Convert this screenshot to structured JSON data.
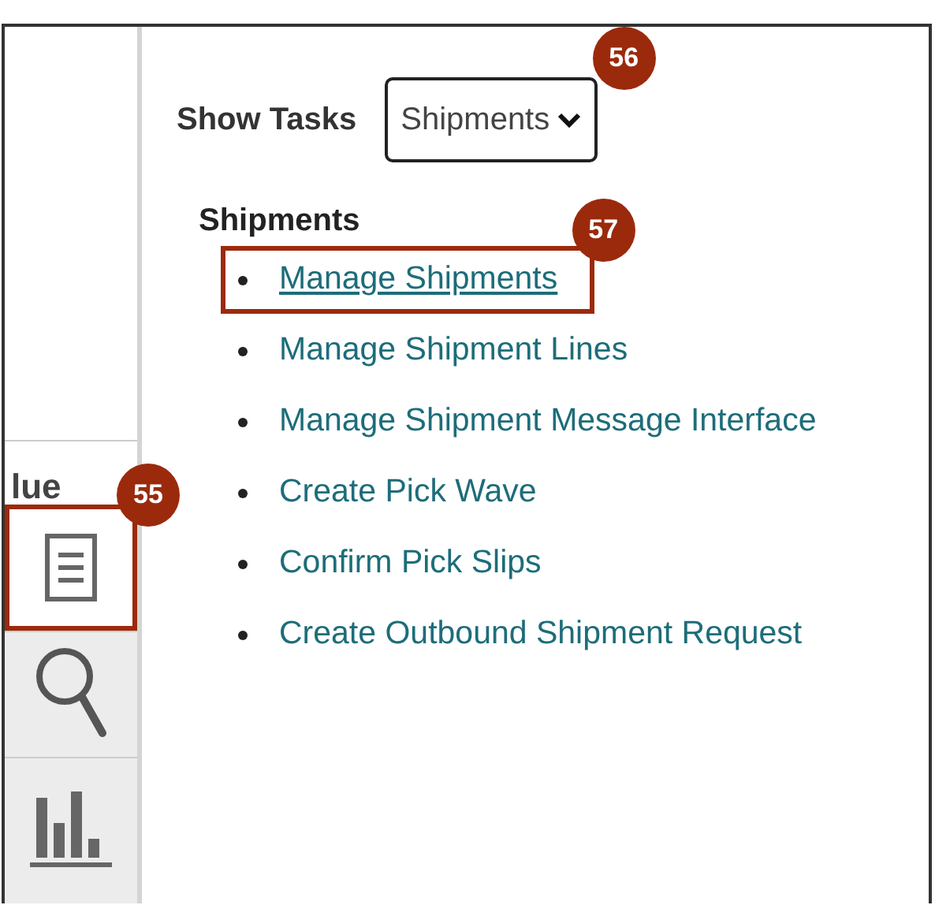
{
  "sidebar": {
    "cut_label": "lue",
    "tools": [
      {
        "kind": "document",
        "selected": true,
        "callout": "55"
      },
      {
        "kind": "search",
        "selected": false
      },
      {
        "kind": "chart",
        "selected": false
      }
    ]
  },
  "show_tasks": {
    "label": "Show Tasks",
    "value": "Shipments",
    "callout": "56"
  },
  "tasks": {
    "heading": "Shipments",
    "items": [
      {
        "label": "Manage Shipments",
        "selected": true,
        "callout": "57"
      },
      {
        "label": "Manage Shipment Lines",
        "selected": false
      },
      {
        "label": "Manage Shipment Message Interface",
        "selected": false
      },
      {
        "label": "Create Pick Wave",
        "selected": false
      },
      {
        "label": "Confirm Pick Slips",
        "selected": false
      },
      {
        "label": "Create Outbound Shipment Request",
        "selected": false
      }
    ]
  }
}
